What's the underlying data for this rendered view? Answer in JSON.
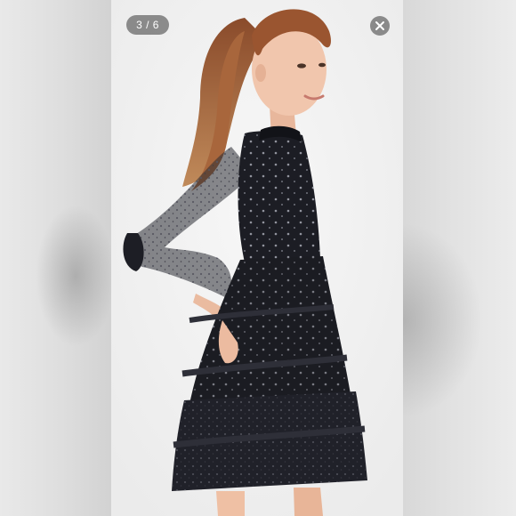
{
  "viewer": {
    "counter_text": "3 / 6",
    "close_icon": "close-icon"
  },
  "photo": {
    "subject": "model-in-black-sequin-tulle-mini-dress",
    "background_color": "#f2f2f2",
    "dress_color": "#1b1c22"
  }
}
